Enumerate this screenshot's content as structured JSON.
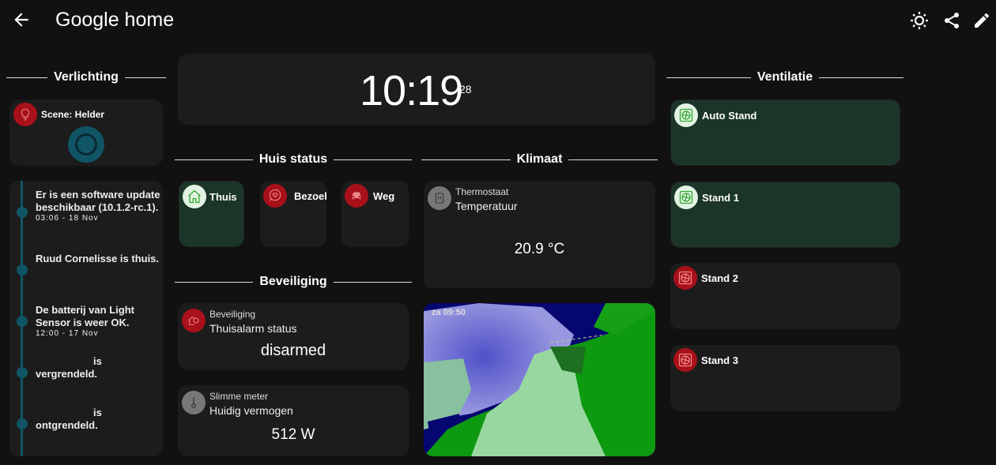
{
  "header": {
    "title": "Google home",
    "actions": [
      "theme-icon",
      "share-icon",
      "edit-icon"
    ]
  },
  "lighting": {
    "heading": "Verlichting",
    "scene": "Scene: Helder"
  },
  "logbook": [
    {
      "text": "Er is een software update beschikbaar (10.1.2-rc.1).",
      "time": "03:06 - 18 Nov"
    },
    {
      "text": "Ruud Cornelisse is thuis.",
      "time": ""
    },
    {
      "text": "De batterij van Light Sensor is weer OK.",
      "time": "12:00 - 17 Nov"
    },
    {
      "text": "is vergrendeld.",
      "time": ""
    },
    {
      "text": "is ontgrendeld.",
      "time": ""
    }
  ],
  "clock": {
    "time": "10:19",
    "seconds": "28"
  },
  "house": {
    "heading": "Huis status",
    "buttons": [
      {
        "label": "Thuis",
        "active": true
      },
      {
        "label": "Bezoek",
        "active": false
      },
      {
        "label": "Weg",
        "active": false
      }
    ]
  },
  "security": {
    "heading": "Beveiliging",
    "alarm": {
      "title": "Beveiliging",
      "name": "Thuisalarm status",
      "value": "disarmed"
    },
    "meter": {
      "title": "Slimme meter",
      "name": "Huidig vermogen",
      "value": "512 W"
    }
  },
  "climate": {
    "heading": "Klimaat",
    "thermostat": {
      "title": "Thermostaat",
      "name": "Temperatuur",
      "value": "20.9 °C"
    },
    "radar_time": "za 09:50"
  },
  "ventilation": {
    "heading": "Ventilatie",
    "buttons": [
      {
        "label": "Auto Stand",
        "active": true
      },
      {
        "label": "Stand 1",
        "active": true
      },
      {
        "label": "Stand 2",
        "active": false
      },
      {
        "label": "Stand 3",
        "active": false
      }
    ]
  },
  "colors": {
    "bg": "#111111",
    "card": "#1c1c1c",
    "active": "#1b3628",
    "red": "#a8101a",
    "teal": "#0f5566"
  }
}
